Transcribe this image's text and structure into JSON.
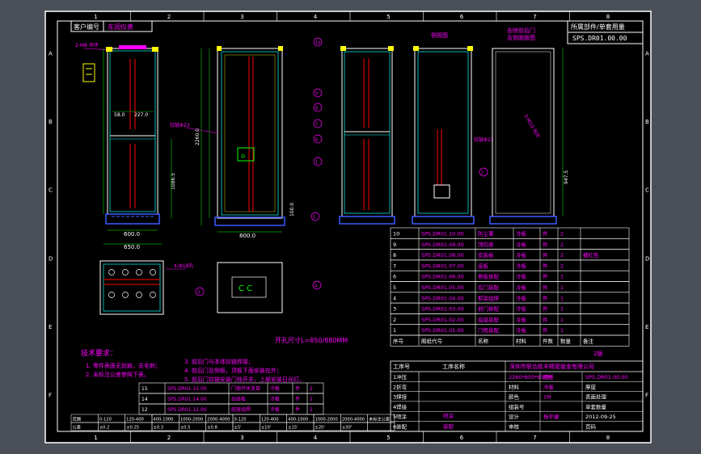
{
  "drawing": {
    "col_marks": [
      "1",
      "2",
      "3",
      "4",
      "5",
      "6",
      "7",
      "8"
    ],
    "row_marks": [
      "A",
      "B",
      "C",
      "D",
      "E",
      "F"
    ],
    "customer_label": "客户编号",
    "customer_value": "东润仪表",
    "parts_header": "所属部件/单套用量",
    "part_ref": "SPS.DR01.00.00",
    "view_label_side": "侧视图",
    "view_label_rear": "去除前后门\n及侧面板图",
    "note_top": "2-M8 吊环",
    "dim_width_front": "600.0",
    "dim_depth": "800.0",
    "dim_width_total": "650.0",
    "dim_height": "2260.0",
    "dim_inner": "1086.5",
    "dim_base": "100.0",
    "dim_58": "58.0",
    "dim_227": "227.0",
    "dim_rear": "947.5",
    "note_hinge": "铰链Φ23",
    "note_base_holes": "4-Φ18孔",
    "opening_size": "开孔尺寸L=850/880MM",
    "balloons": [
      "10",
      "9",
      "8",
      "7",
      "6",
      "5",
      "4",
      "3",
      "2",
      "1"
    ],
    "grounding_symbol": "接地"
  },
  "tech_req": {
    "title": "技术要求：",
    "lines": [
      "1. 零件表面无划痕，去毛刺；",
      "2. 未标注公差参照下表。",
      "3. 前后门与本体铰链焊接；",
      "4. 前后门及侧板，顶板下面安装在外；",
      "5. 前后门铰链安装门栓开关，上部安装日光灯。"
    ]
  },
  "bom": {
    "rows": [
      {
        "no": "10",
        "code": "SPS.DR01.10.00",
        "name": "防尘罩",
        "material": "冷板",
        "unit": "件",
        "qty": "2",
        "note": ""
      },
      {
        "no": "9",
        "code": "SPS.DR01.09.00",
        "name": "顶向梁",
        "material": "冷板",
        "unit": "件",
        "qty": "2",
        "note": ""
      },
      {
        "no": "8",
        "code": "SPS.DR01.08.00",
        "name": "安装板",
        "material": "冷板",
        "unit": "件",
        "qty": "2",
        "note": "橘红色"
      },
      {
        "no": "7",
        "code": "SPS.DR01.07.00",
        "name": "底板",
        "material": "冷板",
        "unit": "件",
        "qty": "2",
        "note": ""
      },
      {
        "no": "6",
        "code": "SPS.DR01.06.00",
        "name": "侧板装配",
        "material": "冷板",
        "unit": "件",
        "qty": "1",
        "note": ""
      },
      {
        "no": "5",
        "code": "SPS.DR01.05.00",
        "name": "后门装配",
        "material": "冷板",
        "unit": "件",
        "qty": "1",
        "note": ""
      },
      {
        "no": "4",
        "code": "SPS.DR01.04.00",
        "name": "框架组焊",
        "material": "冷板",
        "unit": "件",
        "qty": "1",
        "note": ""
      },
      {
        "no": "3",
        "code": "SPS.DR01.03.00",
        "name": "前门装配",
        "material": "冷板",
        "unit": "件",
        "qty": "1",
        "note": ""
      },
      {
        "no": "2",
        "code": "SPS.DR01.02.00",
        "name": "底座装配",
        "material": "冷板",
        "unit": "件",
        "qty": "1",
        "note": ""
      },
      {
        "no": "1",
        "code": "SPS.DR01.01.00",
        "name": "门框装配",
        "material": "冷板",
        "unit": "件",
        "qty": "1",
        "note": ""
      }
    ],
    "header": {
      "no": "序号",
      "code": "图纸代号",
      "name": "名称",
      "material": "材料",
      "unit": "件数",
      "qty": "数量",
      "note": "备注"
    },
    "extra_rows": [
      {
        "no": "15",
        "code": "SPS.DR01.15.00",
        "name": "门锁开关支架",
        "material": "冷板",
        "unit": "件",
        "qty": "2"
      },
      {
        "no": "14",
        "code": "SPS.DR01.14.00",
        "name": "出线板",
        "material": "冷板",
        "unit": "件",
        "qty": "2"
      },
      {
        "no": "12",
        "code": "SPS.DR01.12.00",
        "name": "底座组焊",
        "material": "冷板",
        "unit": "件",
        "qty": "2"
      }
    ]
  },
  "tolerance": {
    "row1": [
      "范围",
      "0-120",
      "120-400",
      "400-1000",
      "1000-2000",
      "2000-4000",
      "0-120",
      "120-400",
      "400-1000",
      "1000-2000",
      "2000-4000",
      "未标注公差"
    ],
    "row2": [
      "公差",
      "±0.2",
      "±0.25",
      "±0.3",
      "±0.5",
      "±0.8",
      "±5'",
      "±10'",
      "±15'",
      "±20'",
      "±30'",
      ""
    ]
  },
  "title_block": {
    "version": "2版",
    "work_header": "工序号",
    "work_name": "工序名称",
    "company": "深圳市联合胜丰精密钣金有限公司",
    "drawing_no_label": "图号",
    "drawing_no": "SPS.DR01.00.00",
    "product_code": "2260*800*650柜",
    "processes": [
      "1冲压",
      "2折弯",
      "3焊接",
      "4焊接",
      "5喷涂",
      "6装配"
    ],
    "material_label": "材料",
    "material": "冷板",
    "thickness_label": "厚度",
    "weight_label": "重量",
    "surface_label": "表面处理",
    "surface": "C",
    "color_label": "颜色",
    "color": "1M",
    "spray_label": "喷粉",
    "parts_label": "组装号",
    "unit_qty_label": "单套数量",
    "designer_label": "设计",
    "designer": "杨平康",
    "checker_label": "审核",
    "date": "2012-09-25",
    "page_label": "页码",
    "spray_note": "喷涂",
    "assembly_note": "装配"
  },
  "colors": {
    "background": "#000000",
    "frame": "#ffffff",
    "outline": "#ffffff",
    "cyan": "#00ffff",
    "magenta": "#ff00ff",
    "yellow": "#ffff00",
    "red": "#ff0000",
    "green": "#00ff00",
    "blue": "#3a5bff"
  }
}
